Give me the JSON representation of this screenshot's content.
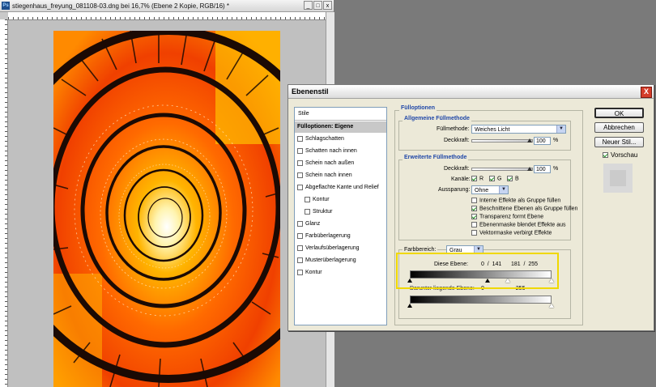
{
  "document": {
    "app_icon": "Ps",
    "title": "stiegenhaus_freyung_081108-03.dng bei 16,7% (Ebene 2 Kopie, RGB/16) *",
    "window_buttons": [
      "_",
      "□",
      "x"
    ]
  },
  "dialog": {
    "title": "Ebenenstil",
    "close_label": "X",
    "styles_header": "Stile",
    "styles": [
      {
        "label": "Fülloptionen: Eigene",
        "selected": true,
        "checkbox": false
      },
      {
        "label": "Schlagschatten",
        "checkbox": true,
        "checked": false
      },
      {
        "label": "Schatten nach innen",
        "checkbox": true,
        "checked": false
      },
      {
        "label": "Schein nach außen",
        "checkbox": true,
        "checked": false
      },
      {
        "label": "Schein nach innen",
        "checkbox": true,
        "checked": false
      },
      {
        "label": "Abgeflachte Kante und Relief",
        "checkbox": true,
        "checked": false
      },
      {
        "label": "Kontur",
        "checkbox": true,
        "checked": false,
        "indent": true
      },
      {
        "label": "Struktur",
        "checkbox": true,
        "checked": false,
        "indent": true
      },
      {
        "label": "Glanz",
        "checkbox": true,
        "checked": false
      },
      {
        "label": "Farbüberlagerung",
        "checkbox": true,
        "checked": false
      },
      {
        "label": "Verlaufsüberlagerung",
        "checkbox": true,
        "checked": false
      },
      {
        "label": "Musterüberlagerung",
        "checkbox": true,
        "checked": false
      },
      {
        "label": "Kontur",
        "checkbox": true,
        "checked": false
      }
    ],
    "fill_options": {
      "section_title": "Fülloptionen",
      "general_title": "Allgemeine Füllmethode",
      "blend_mode_label": "Füllmethode:",
      "blend_mode_value": "Weiches Licht",
      "opacity_label": "Deckkraft:",
      "opacity_value": "100",
      "opacity_unit": "%",
      "advanced_title": "Erweiterte Füllmethode",
      "fill_opacity_label": "Deckkraft:",
      "fill_opacity_value": "100",
      "fill_opacity_unit": "%",
      "channels_label": "Kanäle:",
      "channels": [
        {
          "label": "R",
          "checked": true
        },
        {
          "label": "G",
          "checked": true
        },
        {
          "label": "B",
          "checked": true
        }
      ],
      "knockout_label": "Aussparung:",
      "knockout_value": "Ohne",
      "options": [
        {
          "label": "Interne Effekte als Gruppe füllen",
          "checked": false
        },
        {
          "label": "Beschnittene Ebenen als Gruppe füllen",
          "checked": true
        },
        {
          "label": "Transparenz formt Ebene",
          "checked": true
        },
        {
          "label": "Ebenenmaske blendet Effekte aus",
          "checked": false
        },
        {
          "label": "Vektormaske verbirgt Effekte",
          "checked": false
        }
      ],
      "blend_if_label": "Farbbereich:",
      "blend_if_value": "Grau",
      "this_layer_label": "Diese Ebene:",
      "this_layer_values": "0  /  141      181  /  255",
      "underlying_label": "Darunter liegende Ebene:",
      "underlying_values": "0                    255"
    },
    "buttons": {
      "ok": "OK",
      "cancel": "Abbrechen",
      "new_style": "Neuer Stil...",
      "preview_label": "Vorschau",
      "preview_checked": true
    }
  }
}
